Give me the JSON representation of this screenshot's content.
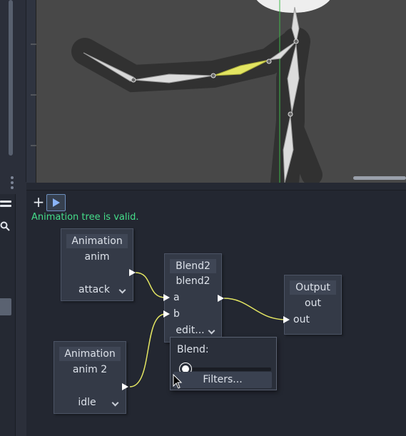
{
  "viewport": {
    "bone_highlight_color": "#e3e562",
    "guide_color": "#3fb94a"
  },
  "tree_editor": {
    "toolbar": {
      "add_icon": "plus-icon",
      "play_icon": "play-icon",
      "add_label": "+"
    },
    "status": "Animation tree is valid.",
    "status_color": "#45de8a",
    "nodes": {
      "anim": {
        "title": "Animation",
        "name": "anim",
        "animation": "attack"
      },
      "anim2": {
        "title": "Animation",
        "name": "anim 2",
        "animation": "idle"
      },
      "blend2": {
        "title": "Blend2",
        "name": "blend2",
        "input_a": "a",
        "input_b": "b",
        "edit_label": "edit..."
      },
      "output": {
        "title": "Output",
        "name": "out",
        "input": "out"
      }
    },
    "blend_popup": {
      "label": "Blend:",
      "blend_value": 0.0,
      "filters_label": "Filters..."
    },
    "connection_color": "#e3e562"
  }
}
